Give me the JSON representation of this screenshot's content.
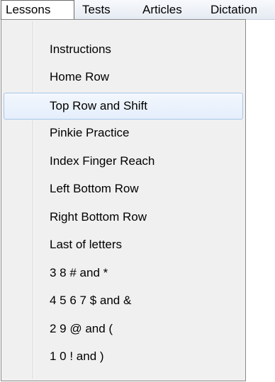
{
  "menubar": {
    "items": [
      {
        "label": "Lessons",
        "active": true
      },
      {
        "label": "Tests"
      },
      {
        "label": "Articles"
      },
      {
        "label": "Dictation"
      }
    ]
  },
  "dropdown": {
    "hovered_index": 2,
    "items": [
      {
        "label": "Instructions"
      },
      {
        "label": "Home Row"
      },
      {
        "label": "Top Row and Shift"
      },
      {
        "label": "Pinkie Practice"
      },
      {
        "label": "Index Finger Reach"
      },
      {
        "label": "Left Bottom Row"
      },
      {
        "label": "Right Bottom Row"
      },
      {
        "label": "Last of letters"
      },
      {
        "label": "3 8 # and *"
      },
      {
        "label": "4 5 6 7 $ and &"
      },
      {
        "label": "2 9 @ and ("
      },
      {
        "label": "1 0 ! and )"
      }
    ]
  }
}
